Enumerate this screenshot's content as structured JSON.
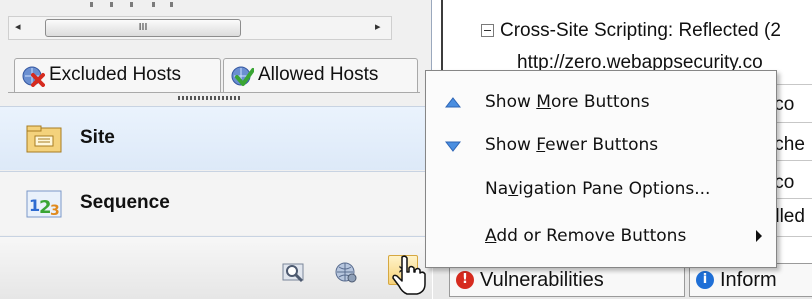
{
  "left_pane": {
    "scrollbar": {
      "left_arrow": "◂",
      "right_arrow": "▸",
      "grip": "III"
    },
    "tabs": [
      {
        "label": "Excluded Hosts",
        "icon": "excluded-hosts-icon"
      },
      {
        "label": "Allowed Hosts",
        "icon": "allowed-hosts-icon"
      }
    ],
    "nav_buttons": [
      {
        "label": "Site",
        "icon": "site-folder-icon",
        "selected": true
      },
      {
        "label": "Sequence",
        "icon": "sequence-123-icon",
        "selected": false
      }
    ],
    "bottom_bar": {
      "icons": [
        "magnifier-icon",
        "globe-gear-icon"
      ],
      "chevron": "»"
    }
  },
  "right_pane": {
    "vuln_header": "Cross-Site Scripting: Reflected (2",
    "vuln_url": "http://zero.webappsecurity.co",
    "edge_texts": [
      ".co",
      "tche",
      ".co",
      "dled"
    ],
    "bottom_tabs": [
      {
        "label": "Vulnerabilities",
        "icon": "red-alert-icon",
        "color": "#d62b1f"
      },
      {
        "label": "Inform",
        "icon": "blue-info-icon",
        "color": "#1f6fd6"
      }
    ]
  },
  "menu": {
    "items": [
      {
        "before": "Show ",
        "mnemonic": "M",
        "after": "ore Buttons",
        "icon": "arrow-up-icon",
        "submenu": false
      },
      {
        "before": "Show ",
        "mnemonic": "F",
        "after": "ewer Buttons",
        "icon": "arrow-down-icon",
        "submenu": false
      },
      {
        "before": "Na",
        "mnemonic": "v",
        "after": "igation Pane Options...",
        "icon": "",
        "submenu": false
      },
      {
        "before": "",
        "mnemonic": "A",
        "after": "dd or Remove Buttons",
        "icon": "",
        "submenu": true
      }
    ]
  },
  "colors": {
    "selected_nav": "#dde9f8",
    "chevron_hover": "#f6d27a",
    "menu_arrow": "#4a8ee0"
  }
}
